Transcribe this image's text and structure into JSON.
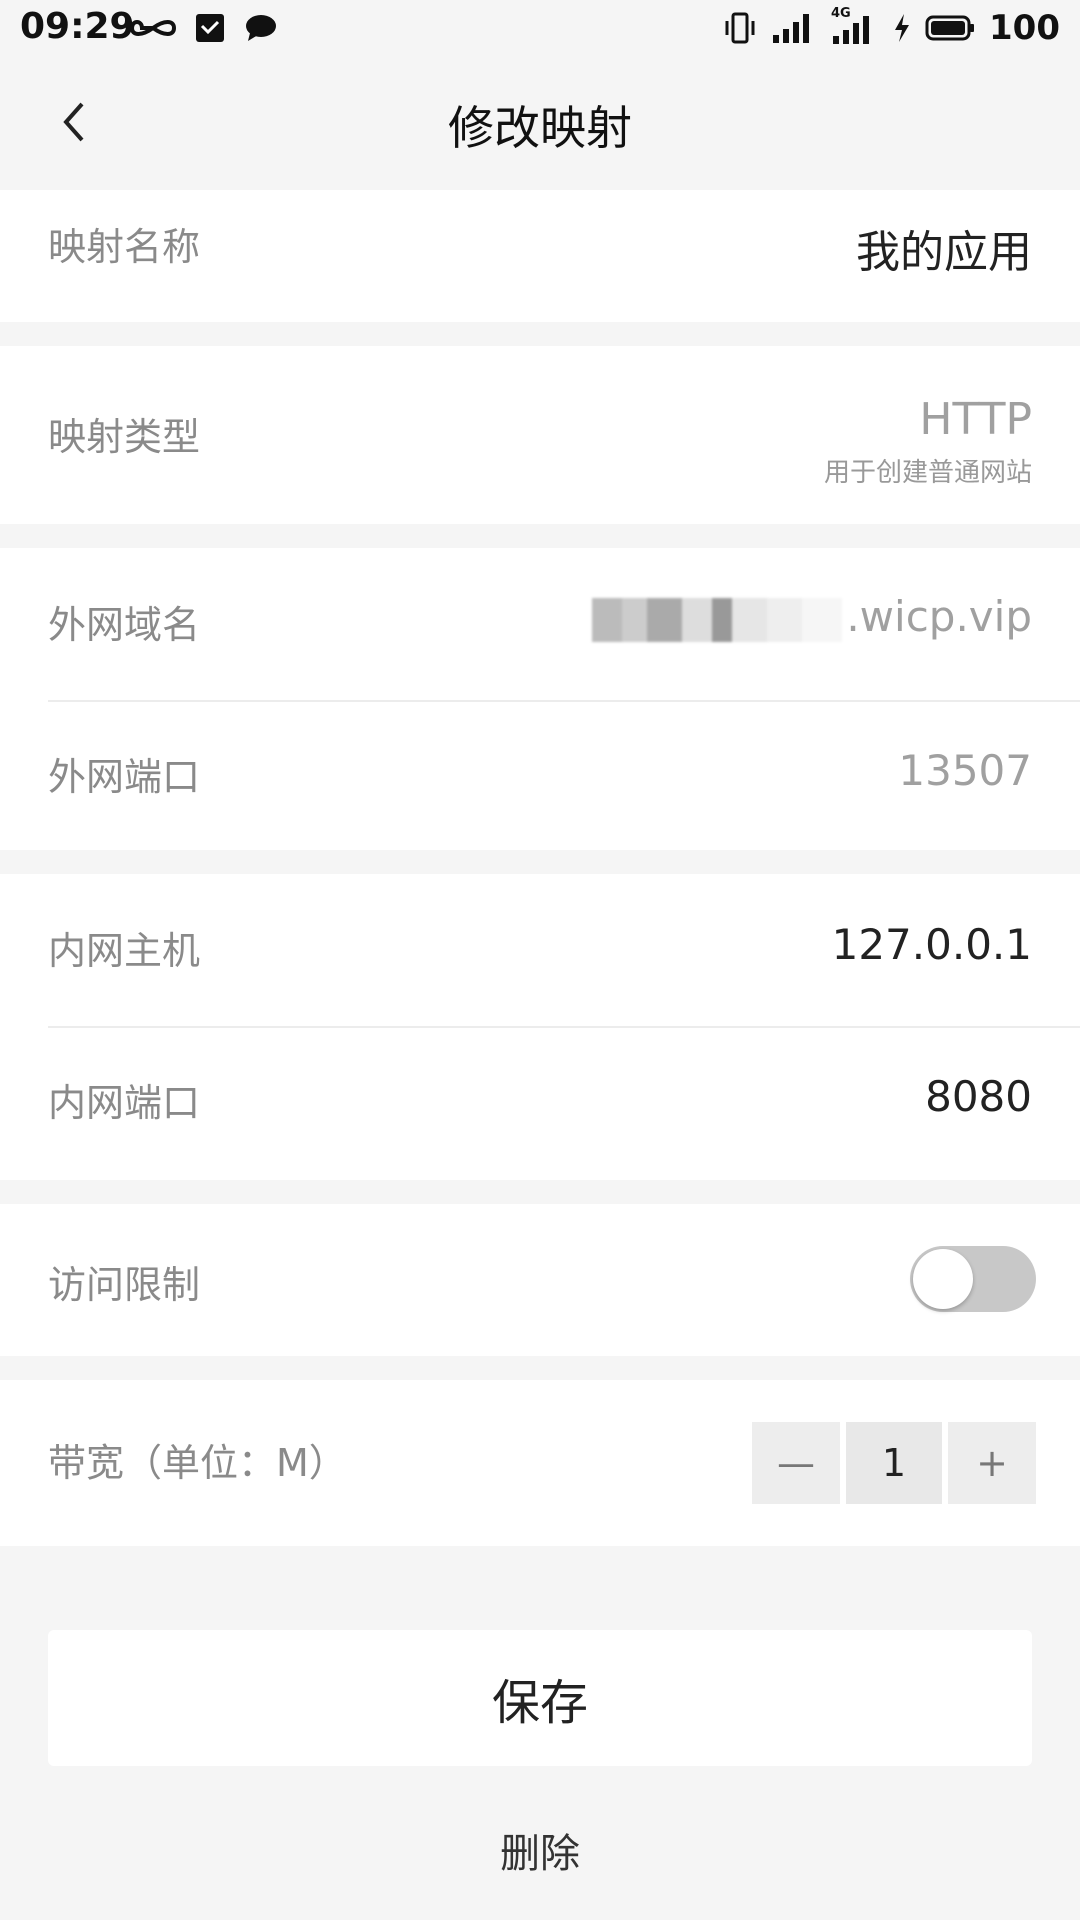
{
  "status_bar": {
    "time": "09:29",
    "battery": "100",
    "network_label": "4G"
  },
  "nav": {
    "title": "修改映射"
  },
  "fields": {
    "mapping_name": {
      "label": "映射名称",
      "value": "我的应用"
    },
    "mapping_type": {
      "label": "映射类型",
      "value": "HTTP",
      "sub": "用于创建普通网站"
    },
    "external_domain": {
      "label": "外网域名",
      "value_suffix": ".wicp.vip"
    },
    "external_port": {
      "label": "外网端口",
      "value": "13507"
    },
    "internal_host": {
      "label": "内网主机",
      "value": "127.0.0.1"
    },
    "internal_port": {
      "label": "内网端口",
      "value": "8080"
    },
    "access_limit": {
      "label": "访问限制",
      "enabled": false
    },
    "bandwidth": {
      "label": "带宽（单位：M）",
      "value": "1",
      "minus": "—",
      "plus": "+"
    }
  },
  "actions": {
    "save_label": "保存",
    "delete_label": "删除"
  }
}
